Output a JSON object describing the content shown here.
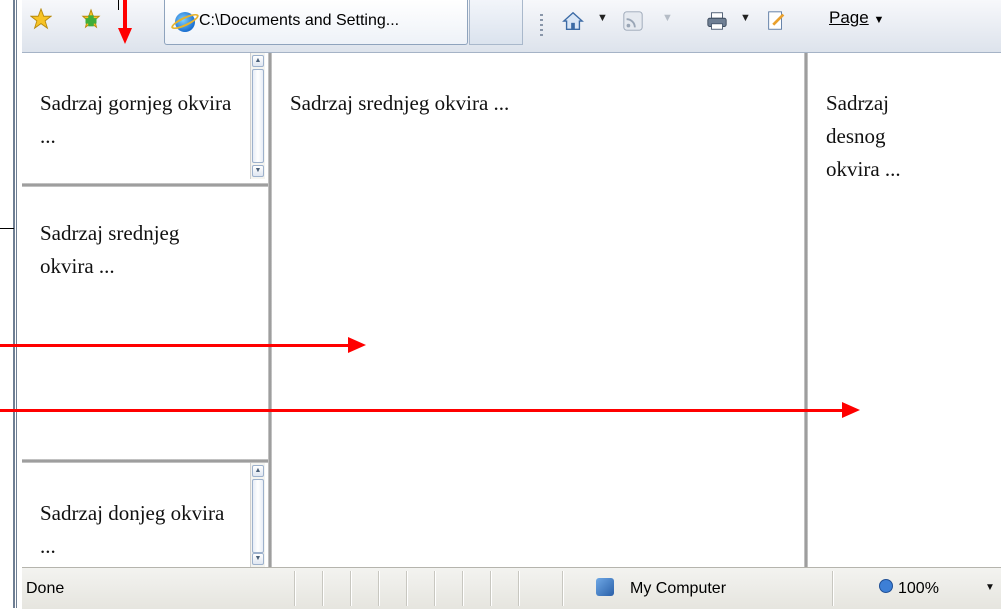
{
  "toolbar": {
    "tab_title": "C:\\Documents and Setting...",
    "page_menu": "Page"
  },
  "frames": {
    "top_left_text": "Sadrzaj gornjeg okvira ...",
    "middle_left_text": "Sadrzaj srednjeg okvira ...",
    "bottom_left_text": "Sadrzaj donjeg okvira ...",
    "center_text": "Sadrzaj srednjeg okvira ...",
    "right_text": "Sadrzaj desnog okvira ..."
  },
  "statusbar": {
    "status": "Done",
    "zone": "My Computer",
    "zoom": "100%"
  },
  "icons": {
    "favorites": "star-icon",
    "add_favorite": "add-favorite-icon",
    "home": "home-icon",
    "feeds": "rss-feed-icon",
    "print": "printer-icon",
    "page": "page-icon",
    "zone": "computer-icon",
    "zoom": "zoom-icon"
  },
  "colors": {
    "annotation": "#ff0000",
    "frame_border": "#8c8c8c"
  }
}
